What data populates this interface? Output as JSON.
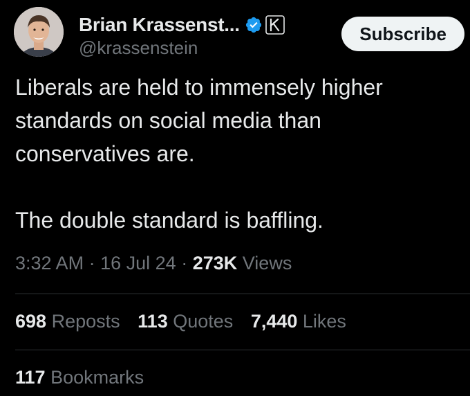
{
  "author": {
    "display_name": "Brian Krassenst...",
    "handle": "@krassenstein",
    "verified_icon": "verified-badge-icon",
    "affiliate_icon": "k-affiliate-badge-icon",
    "avatar_icon": "avatar"
  },
  "subscribe_label": "Subscribe",
  "tweet": {
    "paragraphs": [
      "Liberals are held to immensely higher standards on social media than conservatives are.",
      "The double standard is baffling."
    ]
  },
  "meta": {
    "time": "3:32 AM",
    "separator": "·",
    "date": "16 Jul 24",
    "views_count": "273K",
    "views_label": "Views"
  },
  "stats": {
    "reposts_count": "698",
    "reposts_label": "Reposts",
    "quotes_count": "113",
    "quotes_label": "Quotes",
    "likes_count": "7,440",
    "likes_label": "Likes",
    "bookmarks_count": "117",
    "bookmarks_label": "Bookmarks"
  },
  "colors": {
    "background": "#000000",
    "primary_text": "#e7e9ea",
    "secondary_text": "#71767b",
    "divider": "#2f3336",
    "verified_blue": "#1d9bf0",
    "button_bg": "#eff3f4"
  }
}
